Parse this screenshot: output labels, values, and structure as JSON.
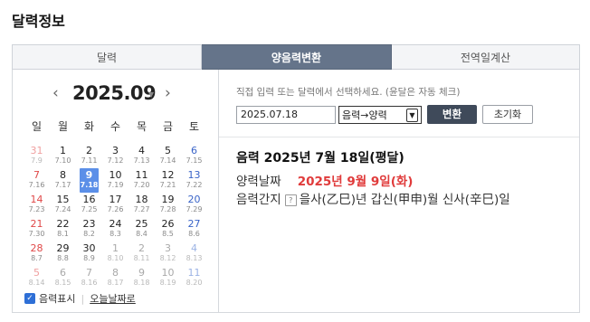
{
  "page_title": "달력정보",
  "tabs": [
    {
      "label": "달력"
    },
    {
      "label": "양음력변환"
    },
    {
      "label": "전역일계산"
    }
  ],
  "calendar": {
    "year_month": "2025.09",
    "weekdays": [
      "일",
      "월",
      "화",
      "수",
      "목",
      "금",
      "토"
    ],
    "days": [
      {
        "d": "31",
        "l": "7.9",
        "other": true
      },
      {
        "d": "1",
        "l": "7.10"
      },
      {
        "d": "2",
        "l": "7.11"
      },
      {
        "d": "3",
        "l": "7.12"
      },
      {
        "d": "4",
        "l": "7.13"
      },
      {
        "d": "5",
        "l": "7.14"
      },
      {
        "d": "6",
        "l": "7.15"
      },
      {
        "d": "7",
        "l": "7.16"
      },
      {
        "d": "8",
        "l": "7.17"
      },
      {
        "d": "9",
        "l": "7.18",
        "selected": true
      },
      {
        "d": "10",
        "l": "7.19"
      },
      {
        "d": "11",
        "l": "7.20"
      },
      {
        "d": "12",
        "l": "7.21"
      },
      {
        "d": "13",
        "l": "7.22"
      },
      {
        "d": "14",
        "l": "7.23"
      },
      {
        "d": "15",
        "l": "7.24"
      },
      {
        "d": "16",
        "l": "7.25"
      },
      {
        "d": "17",
        "l": "7.26"
      },
      {
        "d": "18",
        "l": "7.27"
      },
      {
        "d": "19",
        "l": "7.28"
      },
      {
        "d": "20",
        "l": "7.29"
      },
      {
        "d": "21",
        "l": "7.30"
      },
      {
        "d": "22",
        "l": "8.1"
      },
      {
        "d": "23",
        "l": "8.2"
      },
      {
        "d": "24",
        "l": "8.3"
      },
      {
        "d": "25",
        "l": "8.4"
      },
      {
        "d": "26",
        "l": "8.5"
      },
      {
        "d": "27",
        "l": "8.6"
      },
      {
        "d": "28",
        "l": "8.7"
      },
      {
        "d": "29",
        "l": "8.8"
      },
      {
        "d": "30",
        "l": "8.9"
      },
      {
        "d": "1",
        "l": "8.10",
        "other": true
      },
      {
        "d": "2",
        "l": "8.11",
        "other": true
      },
      {
        "d": "3",
        "l": "8.12",
        "other": true
      },
      {
        "d": "4",
        "l": "8.13",
        "other": true
      },
      {
        "d": "5",
        "l": "8.14",
        "other": true
      },
      {
        "d": "6",
        "l": "8.15",
        "other": true
      },
      {
        "d": "7",
        "l": "8.16",
        "other": true
      },
      {
        "d": "8",
        "l": "8.17",
        "other": true
      },
      {
        "d": "9",
        "l": "8.18",
        "other": true
      },
      {
        "d": "10",
        "l": "8.19",
        "other": true
      },
      {
        "d": "11",
        "l": "8.20",
        "other": true
      }
    ],
    "lunar_toggle_label": "음력표시",
    "today_link": "오늘날짜로"
  },
  "converter": {
    "hint": "직접 입력 또는 달력에서 선택하세요. (윤달은 자동 체크)",
    "date_value": "2025.07.18",
    "mode_selected": "음력→양력",
    "convert_button": "변환",
    "reset_button": "초기화"
  },
  "result": {
    "main": "음력 2025년 7월 18일(평달)",
    "solar_label": "양력날짜",
    "solar_value": "2025년 9월 9일(화)",
    "ganji_label": "음력간지",
    "ganji_value": "을사(乙巳)년 갑신(甲申)월 신사(辛巳)일"
  },
  "colors": {
    "active_tab": "#65748a",
    "selected_day": "#5b8fe8",
    "sunday": "#e04848",
    "saturday": "#3a64c8",
    "result_value": "#e03b3b",
    "convert_button": "#3f4a5a"
  }
}
